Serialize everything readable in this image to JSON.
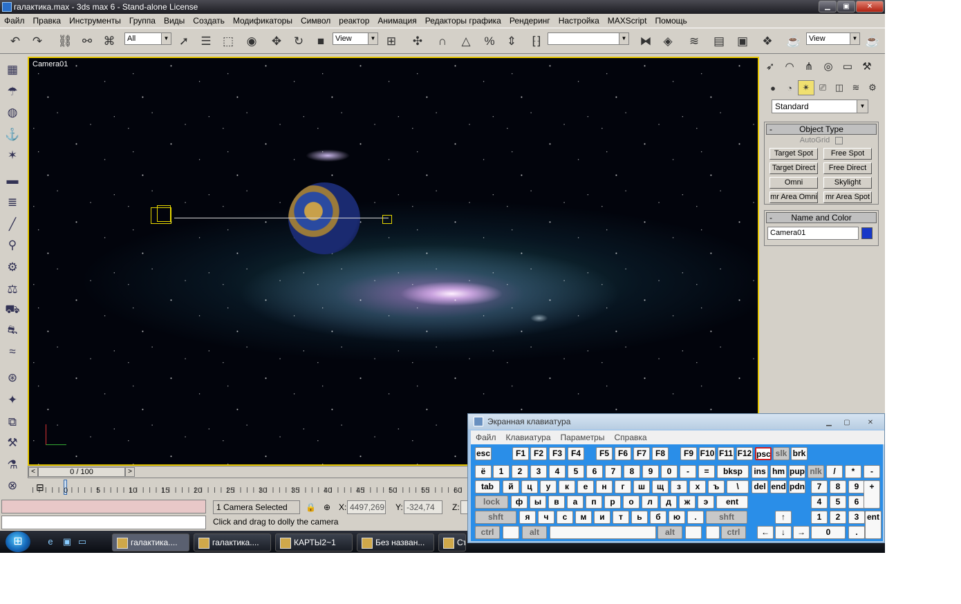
{
  "window": {
    "title": "галактика.max - 3ds max 6 - Stand-alone License"
  },
  "menu": [
    "Файл",
    "Правка",
    "Инструменты",
    "Группа",
    "Виды",
    "Создать",
    "Модификаторы",
    "Символ",
    "реактор",
    "Анимация",
    "Редакторы графика",
    "Рендеринг",
    "Настройка",
    "MAXScript",
    "Помощь"
  ],
  "toolbar": {
    "filter_value": "All",
    "refcoord_value": "View",
    "named_sel_value": "",
    "render_view_value": "View"
  },
  "viewport": {
    "label": "Camera01"
  },
  "command_panel": {
    "category_value": "Standard",
    "object_type_title": "Object Type",
    "autogrid_label": "AutoGrid",
    "buttons": [
      "Target Spot",
      "Free Spot",
      "Target Direct",
      "Free Direct",
      "Omni",
      "Skylight",
      "mr Area Omni",
      "mr Area Spot"
    ],
    "name_color_title": "Name and Color",
    "object_name": "Camera01",
    "object_color": "#1838c8"
  },
  "timeline": {
    "frame_display": "0 / 100",
    "ticks": [
      "0",
      "5",
      "10",
      "15",
      "20",
      "25",
      "30",
      "35",
      "40",
      "45",
      "50",
      "55",
      "60"
    ]
  },
  "status": {
    "selection": "1 Camera Selected",
    "prompt": "Click and drag to dolly the camera",
    "x_label": "X:",
    "x_value": "4497,269",
    "y_label": "Y:",
    "y_value": "-324,74",
    "z_label": "Z:"
  },
  "taskbar": {
    "tasks": [
      "галактика....",
      "галактика....",
      "КАРТЫ2~1",
      "Без назван...",
      "Съ"
    ]
  },
  "osk": {
    "title": "Экранная клавиатура",
    "menu": [
      "Файл",
      "Клавиатура",
      "Параметры",
      "Справка"
    ],
    "row_fn": [
      "esc",
      "F1",
      "F2",
      "F3",
      "F4",
      "F5",
      "F6",
      "F7",
      "F8",
      "F9",
      "F10",
      "F11",
      "F12",
      "psc",
      "slk",
      "brk"
    ],
    "row1": [
      "ё",
      "1",
      "2",
      "3",
      "4",
      "5",
      "6",
      "7",
      "8",
      "9",
      "0",
      "-",
      "=",
      "bksp",
      "ins",
      "hm",
      "pup",
      "nlk",
      "/",
      "*",
      "-"
    ],
    "row2": [
      "tab",
      "й",
      "ц",
      "у",
      "к",
      "е",
      "н",
      "г",
      "ш",
      "щ",
      "з",
      "х",
      "ъ",
      "\\",
      "del",
      "end",
      "pdn",
      "7",
      "8",
      "9",
      "+"
    ],
    "row3": [
      "lock",
      "ф",
      "ы",
      "в",
      "а",
      "п",
      "р",
      "о",
      "л",
      "д",
      "ж",
      "э",
      "ent",
      "4",
      "5",
      "6"
    ],
    "row4": [
      "shft",
      "я",
      "ч",
      "с",
      "м",
      "и",
      "т",
      "ь",
      "б",
      "ю",
      ".",
      "shft",
      "↑",
      "1",
      "2",
      "3",
      "ent"
    ],
    "row5": [
      "ctrl",
      "",
      "alt",
      "",
      "alt",
      "",
      "",
      "ctrl",
      "←",
      "↓",
      "→",
      "0",
      "."
    ]
  }
}
